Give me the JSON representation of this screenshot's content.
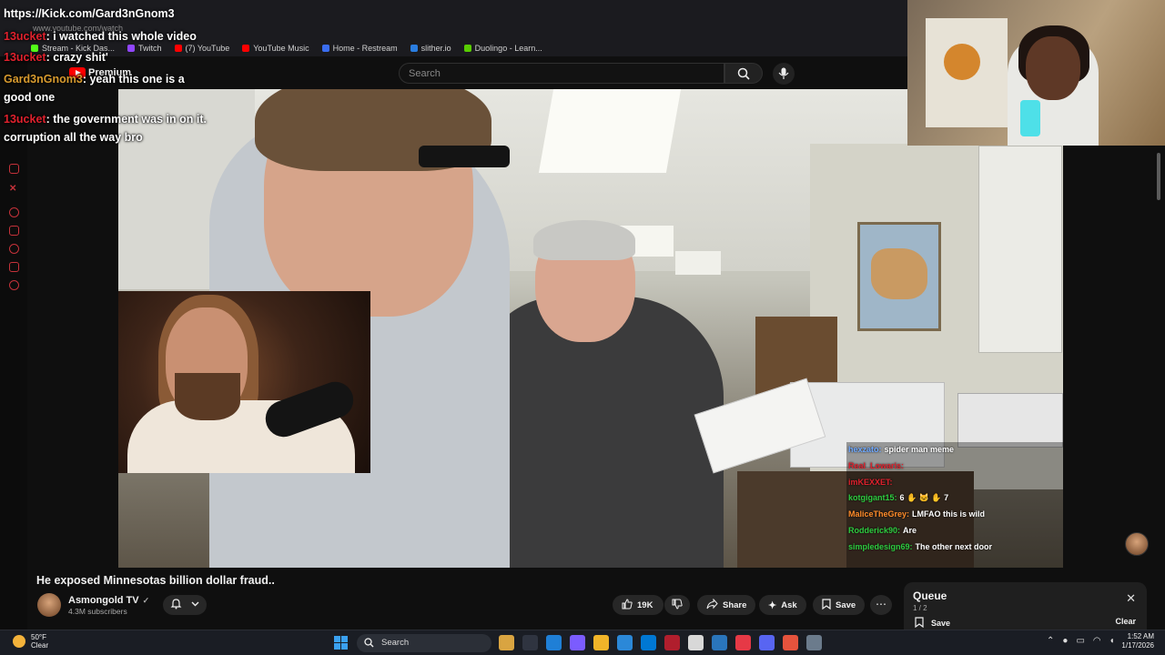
{
  "browser": {
    "address": "www.youtube.com/watch",
    "bookmarks": [
      "Stream - Kick Das...",
      "Twitch",
      "(7) YouTube",
      "YouTube Music",
      "Home - Restream",
      "slither.io",
      "Duolingo - Learn..."
    ],
    "bookmark_colors": [
      "#53fc18",
      "#9146ff",
      "#ff0000",
      "#ff0000",
      "#3a6df0",
      "#2a7de0",
      "#58cc02"
    ]
  },
  "youtube": {
    "brand": "Premium",
    "search_placeholder": "Search",
    "video_title": "He exposed Minnesotas billion dollar fraud..",
    "channel_name": "Asmongold TV",
    "verified": "✓",
    "subscribers": "4.3M subscribers",
    "likes": "19K",
    "share_label": "Share",
    "ask_label": "Ask",
    "save_label": "Save",
    "more_label": "⋯"
  },
  "kick_chat": {
    "url": "https://Kick.com/Gard3nGnom3",
    "messages": [
      {
        "user": "13ucket",
        "text": ": i watched this whole video"
      },
      {
        "user": "13ucket",
        "text": ": crazy shit'"
      },
      {
        "user": "Gard3nGnom3",
        "text": ": yeah this one is a"
      },
      {
        "user": "",
        "text": "good one"
      },
      {
        "user": "13ucket",
        "text": ": the government was in on it."
      },
      {
        "user": "",
        "text": "corruption all the way bro"
      }
    ]
  },
  "twitch_chat": [
    {
      "user": "hexzato:",
      "text": "spider man meme",
      "color": "#6ea8ff"
    },
    {
      "user": "Real_Lowaris:",
      "text": "",
      "color": "#e0212d"
    },
    {
      "user": "imKEXXET:",
      "text": "",
      "color": "#e0212d"
    },
    {
      "user": "kotgigant15:",
      "text": "6 ✋ 🐱 ✋ 7",
      "color": "#2ecc40"
    },
    {
      "user": "MaliceTheGrey:",
      "text": "LMFAO this is wild",
      "color": "#ff8c2a"
    },
    {
      "user": "Rodderick90:",
      "text": "Are",
      "color": "#2ecc40"
    },
    {
      "user": "simpledesign69:",
      "text": "The other next door",
      "color": "#2ecc40"
    }
  ],
  "queue": {
    "title": "Queue",
    "count": "1 / 2",
    "close": "✕",
    "save_label": "Save",
    "clear_label": "Clear"
  },
  "taskbar": {
    "weather_temp": "50°F",
    "weather_desc": "Clear",
    "search_label": "Search",
    "time": "1:52 AM",
    "date": "1/17/2026",
    "app_colors": [
      "#d9a441",
      "#2f3440",
      "#1f7fd6",
      "#7b5cff",
      "#f0b429",
      "#2b88d8",
      "#0078d4",
      "#b01e2d",
      "#d8d8d8",
      "#2a75bb",
      "#e63946",
      "#5865f2",
      "#e5533d",
      "#6b7b8c"
    ]
  }
}
